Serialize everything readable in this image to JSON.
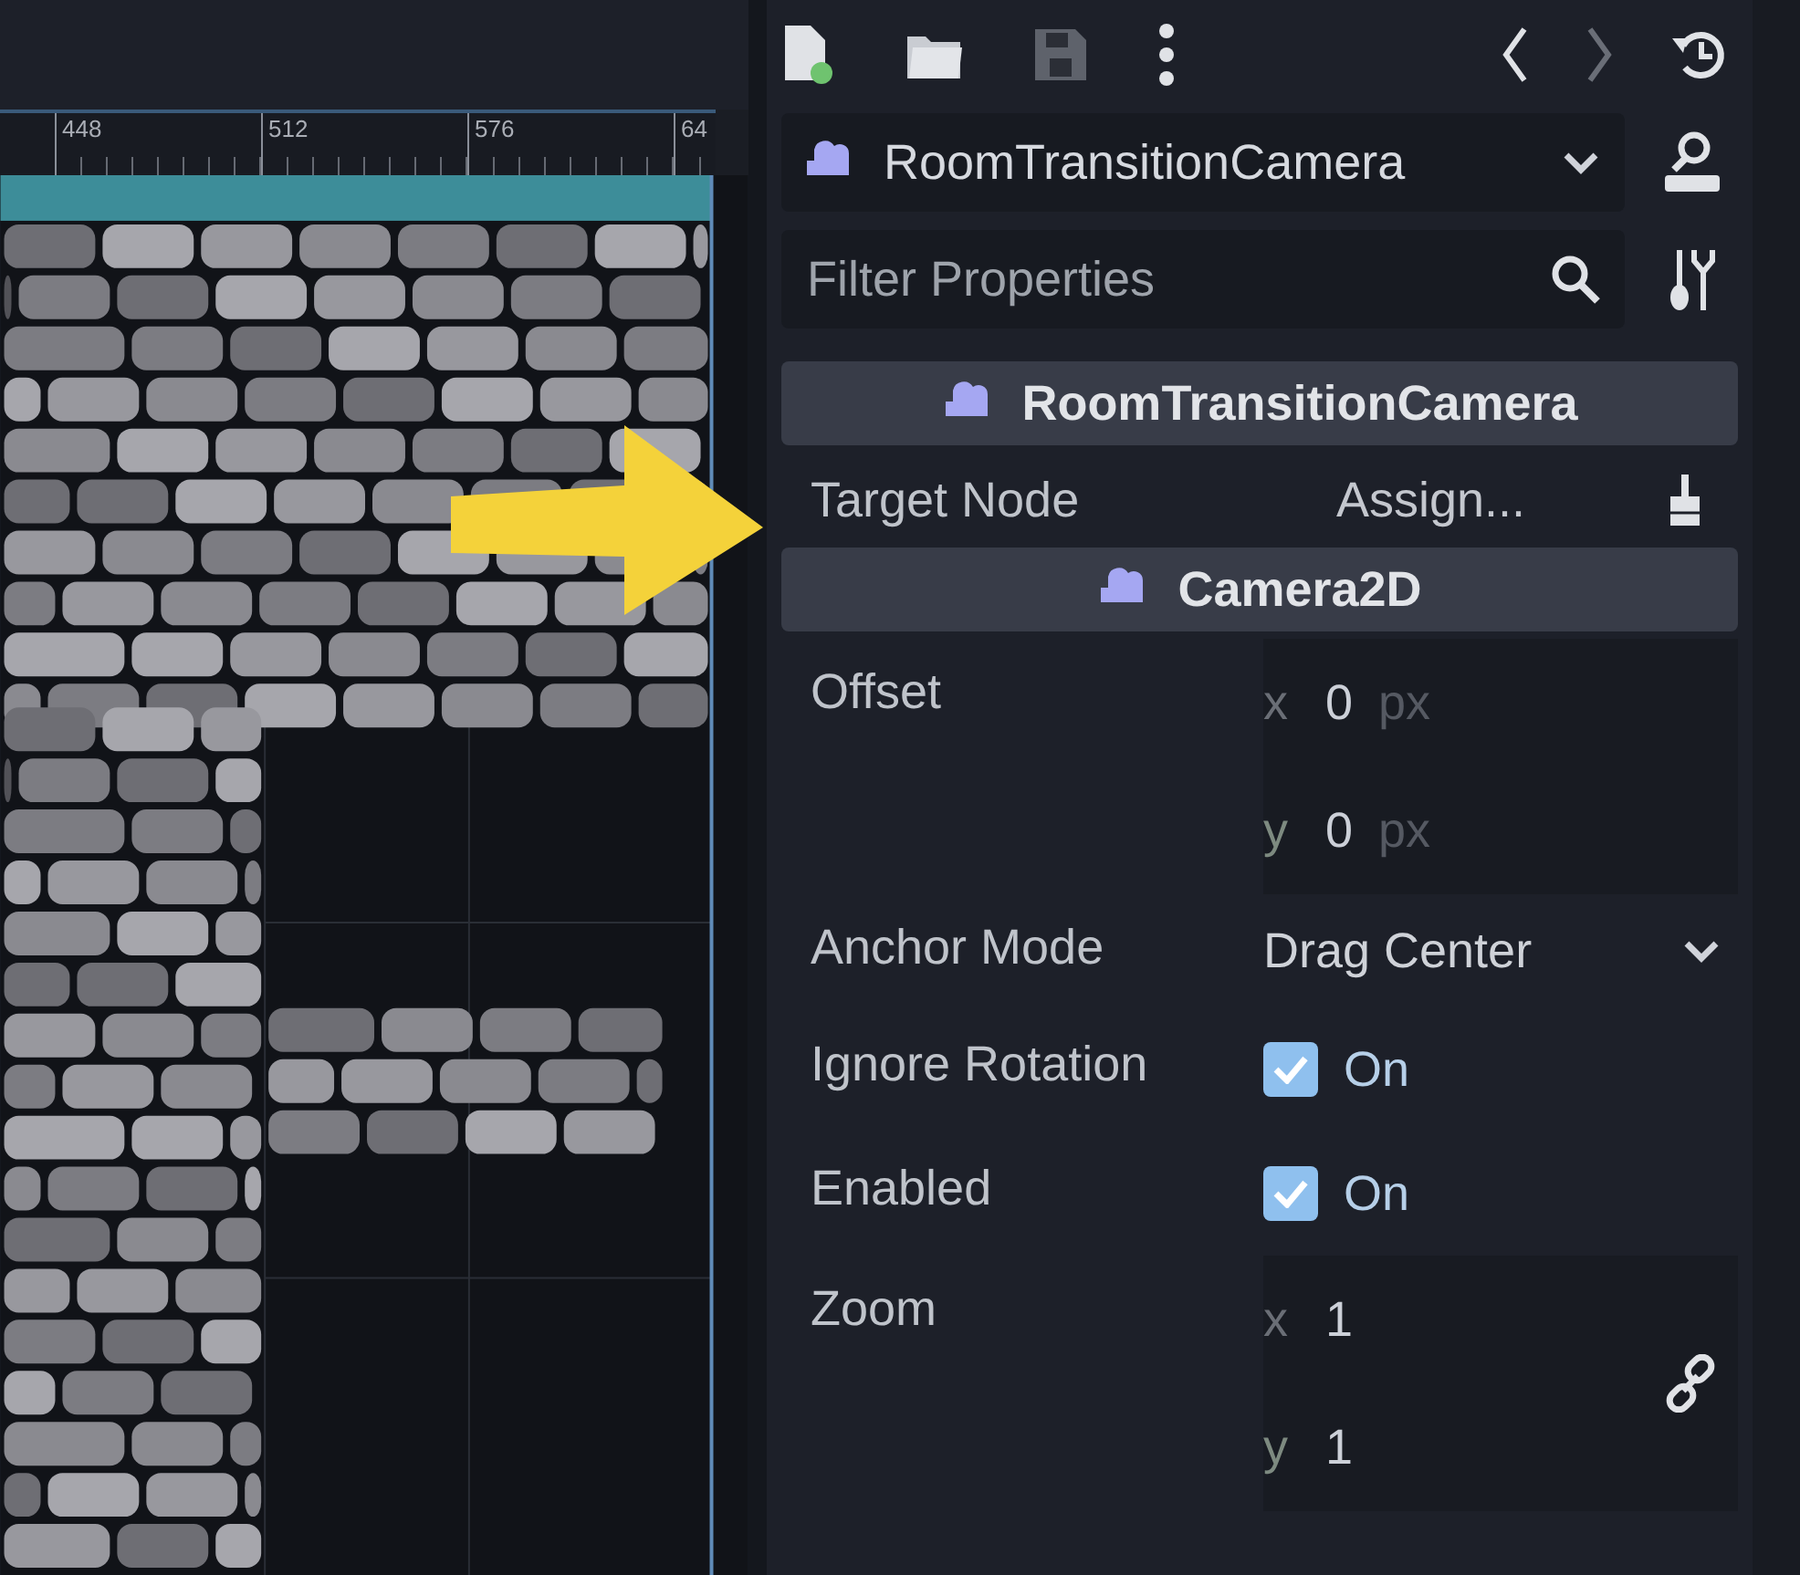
{
  "viewport": {
    "ruler": [
      "448",
      "512",
      "576",
      "64"
    ]
  },
  "inspector": {
    "node_selector": {
      "name": "RoomTransitionCamera"
    },
    "filter": {
      "placeholder": "Filter Properties"
    },
    "sections": [
      {
        "title": "RoomTransitionCamera",
        "properties": [
          {
            "kind": "node",
            "label": "Target Node",
            "value": "Assign..."
          }
        ]
      },
      {
        "title": "Camera2D",
        "properties": [
          {
            "kind": "vector",
            "label": "Offset",
            "components": [
              {
                "axis": "x",
                "value": "0",
                "unit": "px"
              },
              {
                "axis": "y",
                "value": "0",
                "unit": "px"
              }
            ]
          },
          {
            "kind": "enum",
            "label": "Anchor Mode",
            "value": "Drag Center"
          },
          {
            "kind": "bool",
            "label": "Ignore Rotation",
            "checked": true,
            "text": "On"
          },
          {
            "kind": "bool",
            "label": "Enabled",
            "checked": true,
            "text": "On"
          },
          {
            "kind": "vector",
            "label": "Zoom",
            "linked": true,
            "components": [
              {
                "axis": "x",
                "value": "1"
              },
              {
                "axis": "y",
                "value": "1"
              }
            ]
          }
        ]
      }
    ]
  }
}
